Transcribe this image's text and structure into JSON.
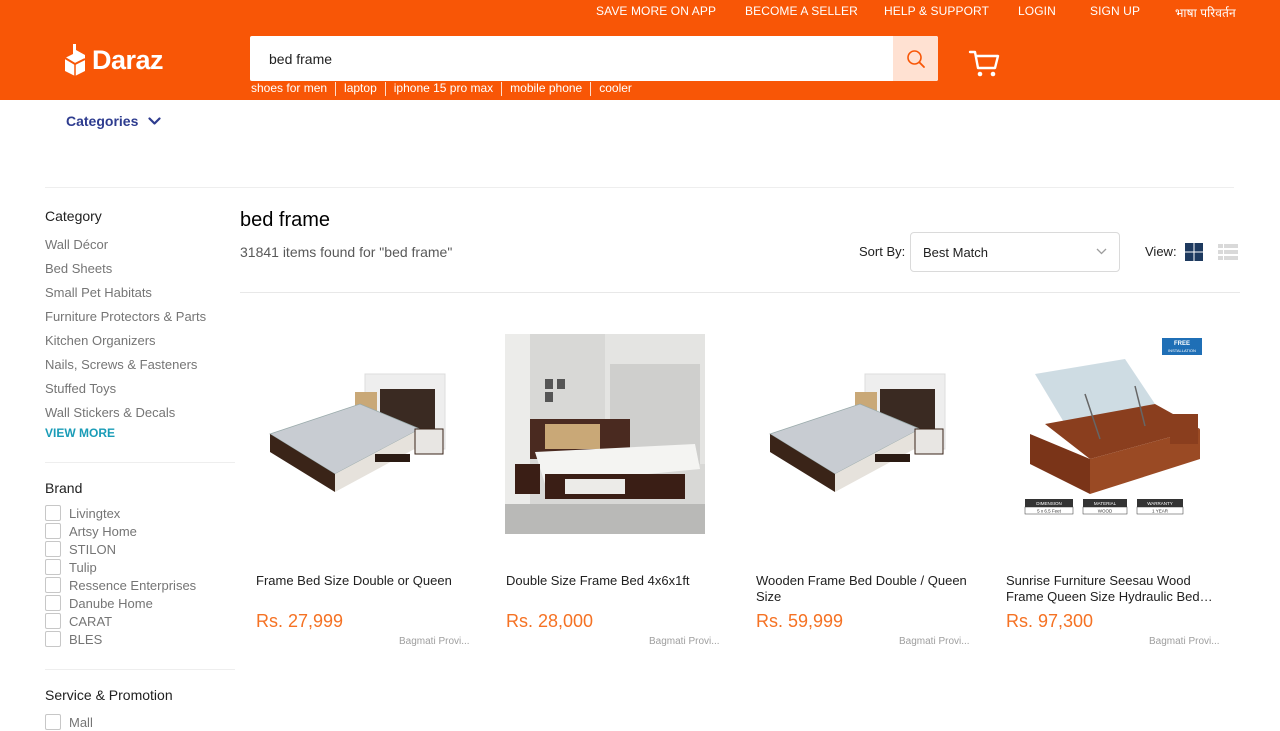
{
  "header": {
    "topnav": [
      "SAVE MORE ON APP",
      "BECOME A SELLER",
      "HELP & SUPPORT",
      "LOGIN",
      "SIGN UP",
      "भाषा परिवर्तन"
    ],
    "logo_text": "Daraz",
    "search_value": "bed frame",
    "suggestions": [
      "shoes for men",
      "laptop",
      "iphone 15 pro max",
      "mobile phone",
      "cooler"
    ],
    "brand_color": "#f85606"
  },
  "nav": {
    "categories_label": "Categories"
  },
  "sidebar": {
    "category_title": "Category",
    "categories": [
      "Wall Décor",
      "Bed Sheets",
      "Small Pet Habitats",
      "Furniture Protectors & Parts",
      "Kitchen Organizers",
      "Nails, Screws & Fasteners",
      "Stuffed Toys",
      "Wall Stickers & Decals"
    ],
    "view_more": "VIEW MORE",
    "brand_title": "Brand",
    "brands": [
      "Livingtex",
      "Artsy Home",
      "STILON",
      "Tulip",
      "Ressence Enterprises",
      "Danube Home",
      "CARAT",
      "BLES"
    ],
    "service_title": "Service & Promotion",
    "services": [
      "Mall"
    ]
  },
  "results": {
    "title": "bed frame",
    "count_text": "31841 items found for \"bed frame\"",
    "sort_label": "Sort By:",
    "sort_value": "Best Match",
    "view_label": "View:"
  },
  "products": [
    {
      "name": "Frame Bed Size Double or Queen",
      "price": "Rs. 27,999",
      "location": "Bagmati Provi..."
    },
    {
      "name": "Double Size Frame Bed 4x6x1ft",
      "price": "Rs. 28,000",
      "location": "Bagmati Provi..."
    },
    {
      "name": "Wooden Frame Bed Double / Queen Size",
      "price": "Rs. 59,999",
      "location": "Bagmati Provi..."
    },
    {
      "name": "Sunrise Furniture Seesau Wood Frame Queen Size Hydraulic Bed…",
      "price": "Rs. 97,300",
      "location": "Bagmati Provi...",
      "badge": [
        "FREE",
        "INSTALLATION"
      ],
      "specs": [
        "DIMENSION",
        "5 x 6.5 Feet",
        "MATERIAL",
        "WOOD",
        "WARRANTY",
        "1 YEAR"
      ]
    }
  ]
}
